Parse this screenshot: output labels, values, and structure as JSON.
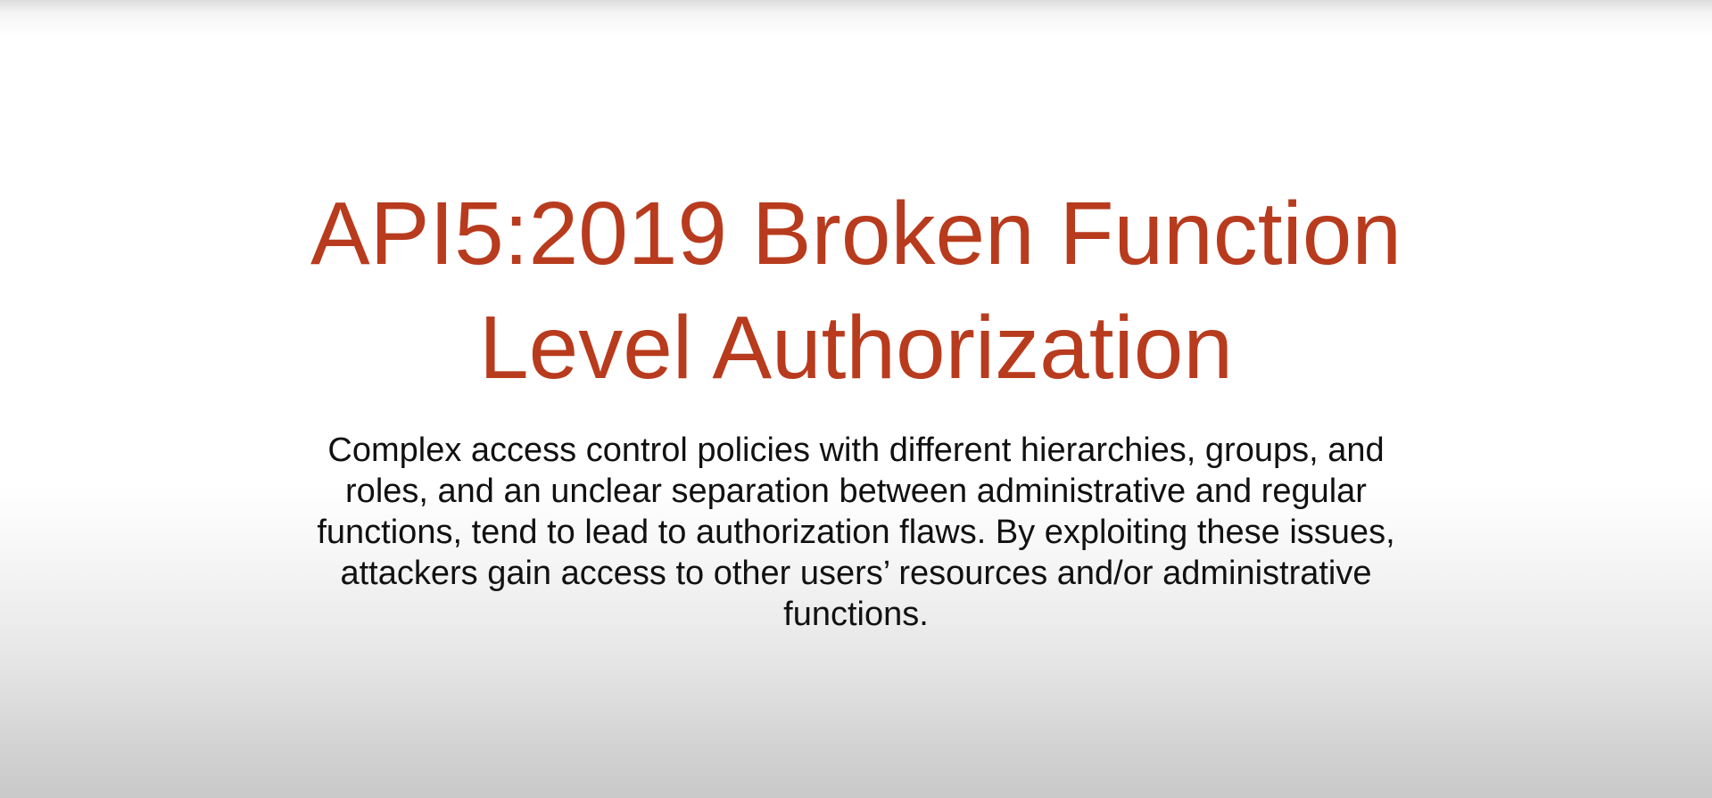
{
  "slide": {
    "title_lines": [
      "API5:2019 Broken Function",
      "Level Authorization"
    ],
    "body_lines": [
      "Complex access control policies with different hierarchies, groups, and",
      "roles, and an unclear separation between administrative and regular",
      "functions, tend to lead to authorization flaws. By exploiting these issues,",
      "attackers gain access to other users’ resources and/or administrative",
      "functions."
    ],
    "title_color": "#b83b1e",
    "text_color": "#111111"
  }
}
